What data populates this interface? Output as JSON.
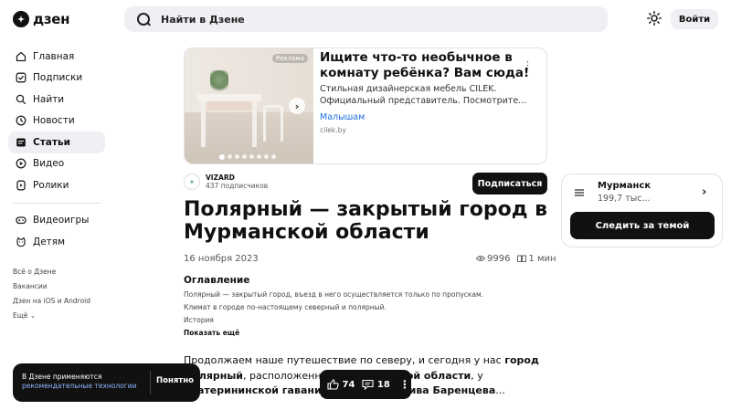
{
  "header": {
    "logo_text": "дзен",
    "search_placeholder": "Найти в Дзене",
    "login_label": "Войти"
  },
  "sidebar": {
    "items": [
      {
        "label": "Главная",
        "icon": "home-icon"
      },
      {
        "label": "Подписки",
        "icon": "subscriptions-icon"
      },
      {
        "label": "Найти",
        "icon": "search-icon"
      },
      {
        "label": "Новости",
        "icon": "news-icon"
      },
      {
        "label": "Статьи",
        "icon": "articles-icon",
        "active": true
      },
      {
        "label": "Видео",
        "icon": "video-icon"
      },
      {
        "label": "Ролики",
        "icon": "clips-icon"
      }
    ],
    "extra_items": [
      {
        "label": "Видеоигры",
        "icon": "gamepad-icon"
      },
      {
        "label": "Детям",
        "icon": "kids-icon"
      }
    ],
    "footer_links": [
      "Всё о Дзене",
      "Вакансии",
      "Дзен на iOS и Android",
      "Ещё"
    ]
  },
  "ad": {
    "badge": "Реклама",
    "title": "Ищите что-то необычное в комнату ребёнка? Вам сюда!",
    "description": "Стильная дизайнерская мебель CILEK. Официальный представитель. Посмотрите...",
    "link_text": "Малышам",
    "domain": "cilek.by"
  },
  "channel": {
    "name": "VIZARD",
    "subscribers": "437 подписчиков",
    "subscribe_label": "Подписаться"
  },
  "article": {
    "title": "Полярный — закрытый город в Мурманской области",
    "date": "16 ноября 2023",
    "views": "9996",
    "read_time": "1 мин",
    "toc_title": "Оглавление",
    "toc_items": [
      "Полярный — закрытый город, въезд в него осуществляется только по пропускам.",
      "Климат в городе по-настоящему северный и полярный.",
      "История"
    ],
    "toc_more": "Показать ещё",
    "para_start": "Продолжаем наше путешествие по северу, и сегодня у нас ",
    "para_bold1": "город Полярный",
    "para_mid": ", расположенный в ",
    "para_bold2": "Мурманской области",
    "para_mid2": ", у ",
    "para_bold3": "Екатерининской гавани Кольского залива Баренцева",
    "para_end": "..."
  },
  "topic": {
    "name": "Мурманск",
    "count": "199,7 тыс...",
    "follow_label": "Следить за темой"
  },
  "cookie": {
    "text": "В Дзене применяются",
    "link": "рекомендательные технологии",
    "button": "Понятно"
  },
  "reactions": {
    "likes": "74",
    "comments": "18"
  }
}
